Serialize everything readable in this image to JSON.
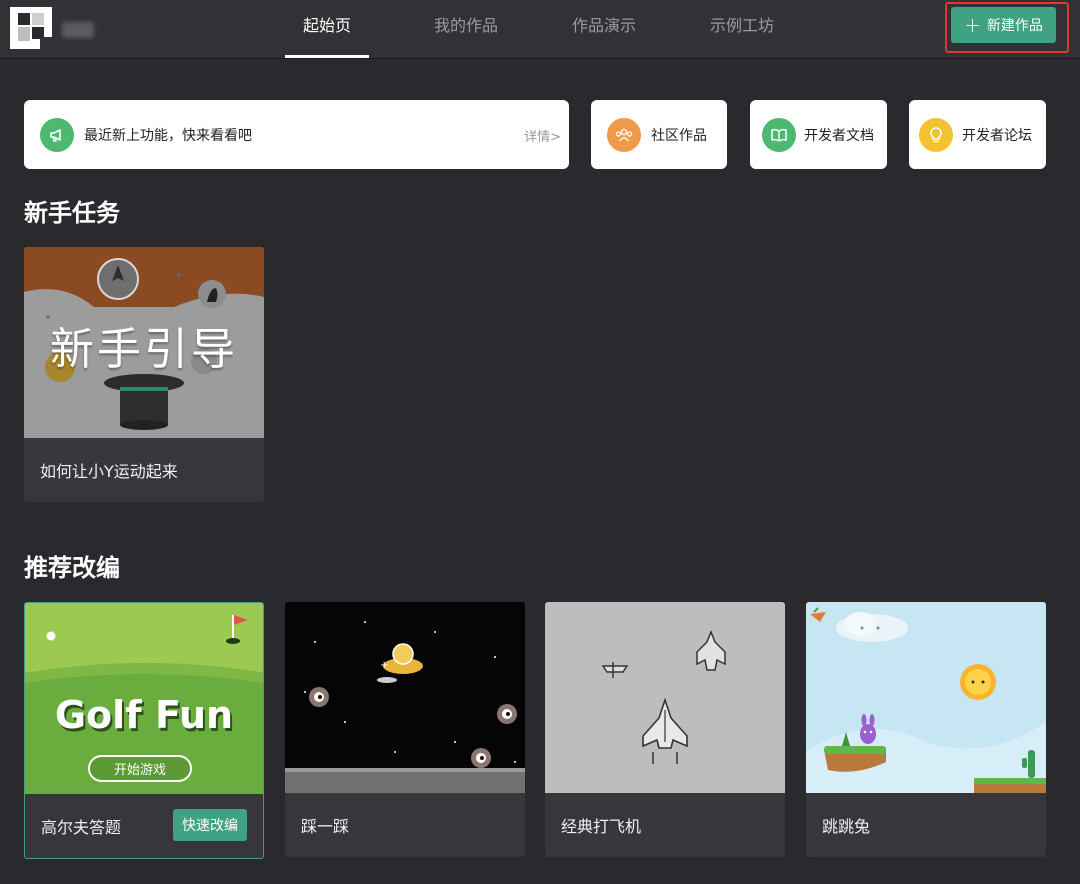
{
  "nav": {
    "tabs": [
      {
        "label": "起始页",
        "active": true
      },
      {
        "label": "我的作品",
        "active": false
      },
      {
        "label": "作品演示",
        "active": false
      },
      {
        "label": "示例工坊",
        "active": false
      }
    ],
    "new_button": {
      "icon": "plus-icon",
      "label": "新建作品"
    }
  },
  "quick_links": {
    "news": {
      "icon": "megaphone-icon",
      "text": "最近新上功能，快来看看吧",
      "detail": "详情>"
    },
    "community": {
      "icon": "people-icon",
      "label": "社区作品"
    },
    "docs": {
      "icon": "book-icon",
      "label": "开发者文档"
    },
    "forum": {
      "icon": "lightbulb-icon",
      "label": "开发者论坛"
    }
  },
  "novice": {
    "title": "新手任务",
    "card": {
      "thumb_text": "新手引导",
      "caption": "如何让小Y运动起来"
    }
  },
  "recommended": {
    "title": "推荐改编",
    "cards": [
      {
        "caption": "高尔夫答题",
        "thumb_title": "Golf Fun",
        "thumb_button": "开始游戏",
        "remix_label": "快速改编"
      },
      {
        "caption": "踩一踩"
      },
      {
        "caption": "经典打飞机"
      },
      {
        "caption": "跳跳兔"
      }
    ]
  },
  "colors": {
    "background": "#2a2a2e",
    "topbar": "#323236",
    "accent_green": "#3fa383",
    "highlight_red": "#e0392b",
    "icon_green": "#4cb870",
    "icon_orange": "#ef9a4a",
    "icon_yellow": "#f2c230"
  }
}
